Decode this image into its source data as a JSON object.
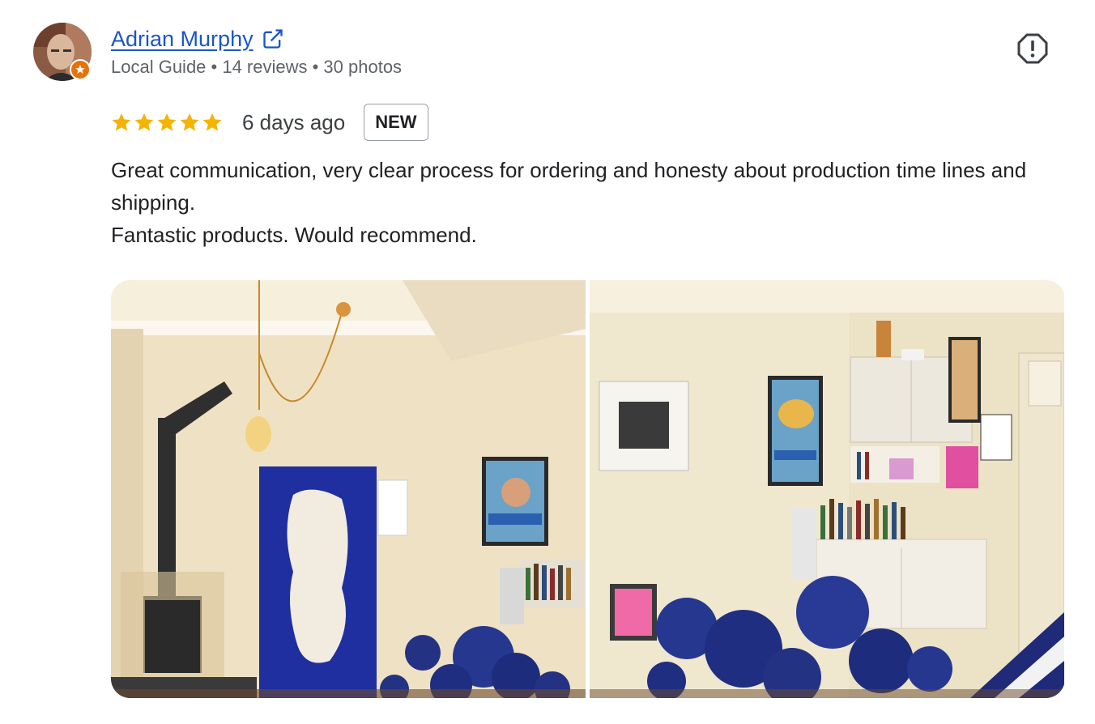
{
  "author": {
    "name": "Adrian Murphy",
    "meta": "Local Guide • 14 reviews • 30 photos",
    "avatar_icon": "user-avatar",
    "badge_icon": "local-guide-star-icon"
  },
  "review": {
    "rating": 5,
    "rating_max": 5,
    "date": "6 days ago",
    "badge": "NEW",
    "text_line1": "Great communication, very clear process for ordering and honesty about production time lines and shipping.",
    "text_line2": "Fantastic products. Would recommend."
  },
  "icons": {
    "external_link": "external-link-icon",
    "report": "report-icon",
    "star": "star-icon"
  },
  "colors": {
    "link": "#1a56c8",
    "star": "#f4b400",
    "badge": "#e8710a",
    "meta_text": "#5f6368"
  }
}
